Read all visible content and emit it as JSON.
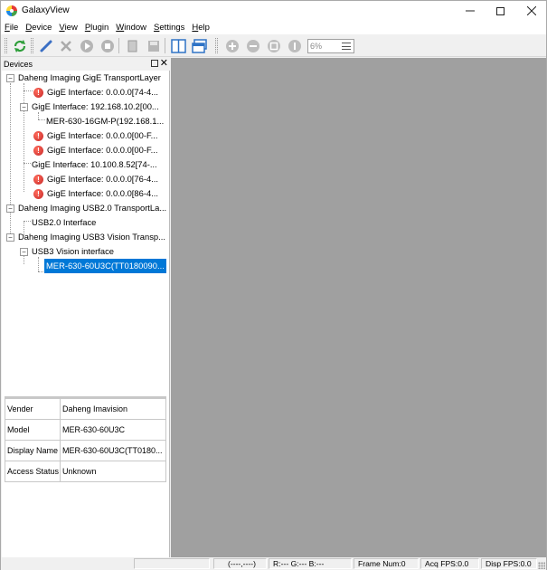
{
  "window": {
    "title": "GalaxyView"
  },
  "menu": [
    {
      "label": "File",
      "key": "F",
      "rest": "ile"
    },
    {
      "label": "Device",
      "key": "D",
      "rest": "evice"
    },
    {
      "label": "View",
      "key": "V",
      "rest": "iew"
    },
    {
      "label": "Plugin",
      "key": "P",
      "rest": "lugin"
    },
    {
      "label": "Window",
      "key": "W",
      "rest": "indow"
    },
    {
      "label": "Settings",
      "key": "S",
      "rest": "ettings"
    },
    {
      "label": "Help",
      "key": "H",
      "rest": "elp"
    }
  ],
  "toolbar": {
    "zoom_value": "6%"
  },
  "devices_panel": {
    "title": "Devices",
    "tree": [
      {
        "text": "Daheng Imaging GigE TransportLayer",
        "level": 0,
        "icon": "none"
      },
      {
        "text": "GigE Interface: 0.0.0.0[74-4...",
        "level": 1,
        "icon": "error-icon"
      },
      {
        "text": "GigE Interface: 192.168.10.2[00...",
        "level": 1,
        "icon": "none"
      },
      {
        "text": "MER-630-16GM-P(192.168.1...",
        "level": 2,
        "icon": "none"
      },
      {
        "text": "GigE Interface: 0.0.0.0[00-F...",
        "level": 1,
        "icon": "error-icon"
      },
      {
        "text": "GigE Interface: 0.0.0.0[00-F...",
        "level": 1,
        "icon": "error-icon"
      },
      {
        "text": "GigE Interface: 10.100.8.52[74-...",
        "level": 1,
        "icon": "none"
      },
      {
        "text": "GigE Interface: 0.0.0.0[76-4...",
        "level": 1,
        "icon": "error-icon"
      },
      {
        "text": "GigE Interface: 0.0.0.0[86-4...",
        "level": 1,
        "icon": "error-icon"
      },
      {
        "text": "Daheng Imaging USB2.0 TransportLa...",
        "level": 0,
        "icon": "none"
      },
      {
        "text": "USB2.0 Interface",
        "level": 1,
        "icon": "none"
      },
      {
        "text": "Daheng Imaging USB3 Vision Transp...",
        "level": 0,
        "icon": "none"
      },
      {
        "text": "USB3 Vision interface",
        "level": 1,
        "icon": "none"
      },
      {
        "text": "MER-630-60U3C(TT0180090...",
        "level": 2,
        "icon": "none",
        "selected": true
      }
    ]
  },
  "properties": [
    {
      "key": "Vender",
      "value": "Daheng Imavision"
    },
    {
      "key": "Model",
      "value": "MER-630-60U3C"
    },
    {
      "key": "Display Name",
      "value": "MER-630-60U3C(TT0180..."
    },
    {
      "key": "Access Status",
      "value": "Unknown"
    }
  ],
  "statusbar": {
    "coords": "(----,----)",
    "rgb": "R:--- G:--- B:---",
    "frame_num": "Frame Num:0",
    "acq_fps": "Acq FPS:0.0",
    "disp_fps": "Disp FPS:0.0"
  },
  "colors": {
    "canvas": "#a0a0a0",
    "selection": "#0078d7",
    "error": "#d32f2f"
  }
}
